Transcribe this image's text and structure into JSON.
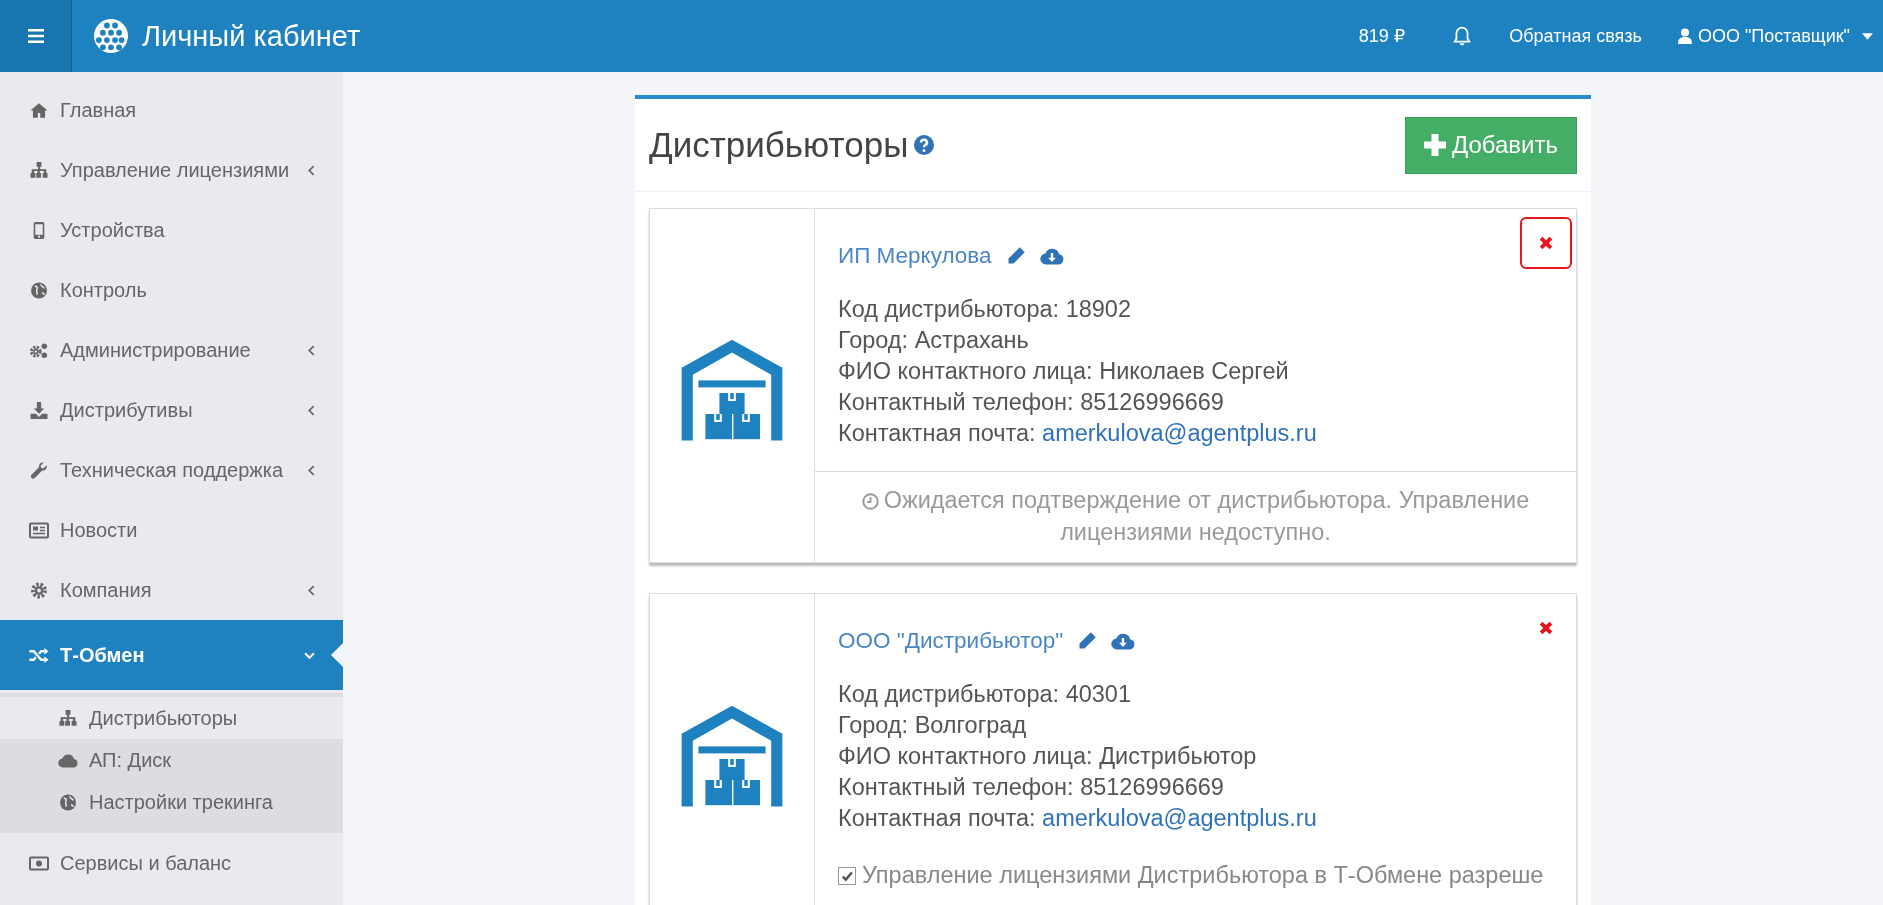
{
  "header": {
    "title": "Личный кабинет",
    "balance": "819 ₽",
    "feedback": "Обратная связь",
    "user": "ООО \"Поставщик\""
  },
  "sidebar": {
    "items": [
      {
        "label": "Главная",
        "has_submenu": false,
        "selected": false
      },
      {
        "label": "Управление лицензиями",
        "has_submenu": true,
        "selected": false,
        "expanded": false
      },
      {
        "label": "Устройства",
        "has_submenu": false,
        "selected": false
      },
      {
        "label": "Контроль",
        "has_submenu": false,
        "selected": false
      },
      {
        "label": "Администрирование",
        "has_submenu": true,
        "selected": false,
        "expanded": false
      },
      {
        "label": "Дистрибутивы",
        "has_submenu": true,
        "selected": false,
        "expanded": false
      },
      {
        "label": "Техническая поддержка",
        "has_submenu": true,
        "selected": false,
        "expanded": false
      },
      {
        "label": "Новости",
        "has_submenu": false,
        "selected": false
      },
      {
        "label": "Компания",
        "has_submenu": true,
        "selected": false,
        "expanded": false
      },
      {
        "label": "Т-Обмен",
        "has_submenu": true,
        "selected": true,
        "expanded": true,
        "children": [
          {
            "label": "Дистрибьюторы",
            "selected": true
          },
          {
            "label": "АП: Диск",
            "selected": false
          },
          {
            "label": "Настройки трекинга",
            "selected": false
          }
        ]
      },
      {
        "label": "Сервисы и баланс",
        "has_submenu": false,
        "selected": false
      }
    ]
  },
  "panel": {
    "title": "Дистрибьюторы",
    "add_button": "Добавить",
    "distributors": [
      {
        "name": "ИП Меркулова",
        "delete_highlighted": true,
        "fields": [
          {
            "label": "Код дистрибьютора:",
            "value": "18902"
          },
          {
            "label": "Город:",
            "value": "Астрахань"
          },
          {
            "label": "ФИО контактного лица:",
            "value": "Николаев Сергей"
          },
          {
            "label": "Контактный телефон:",
            "value": "85126996669"
          },
          {
            "label": "Контактная почта:",
            "value": "amerkulova@agentplus.ru",
            "kind": "link"
          }
        ],
        "footer": {
          "kind": "status",
          "text": "Ожидается подтверждение от дистрибьютора. Управление лицензиями недоступно."
        }
      },
      {
        "name": "ООО \"Дистрибьютор\"",
        "delete_highlighted": false,
        "fields": [
          {
            "label": "Код дистрибьютора:",
            "value": "40301"
          },
          {
            "label": "Город:",
            "value": "Волгоград"
          },
          {
            "label": "ФИО контактного лица:",
            "value": "Дистрибьютор"
          },
          {
            "label": "Контактный телефон:",
            "value": "85126996669"
          },
          {
            "label": "Контактная почта:",
            "value": "amerkulova@agentplus.ru",
            "kind": "link"
          }
        ],
        "footer": {
          "kind": "permission",
          "text": "Управление лицензиями Дистрибьютора в Т-Обмене разреше",
          "checked": true
        }
      }
    ]
  }
}
